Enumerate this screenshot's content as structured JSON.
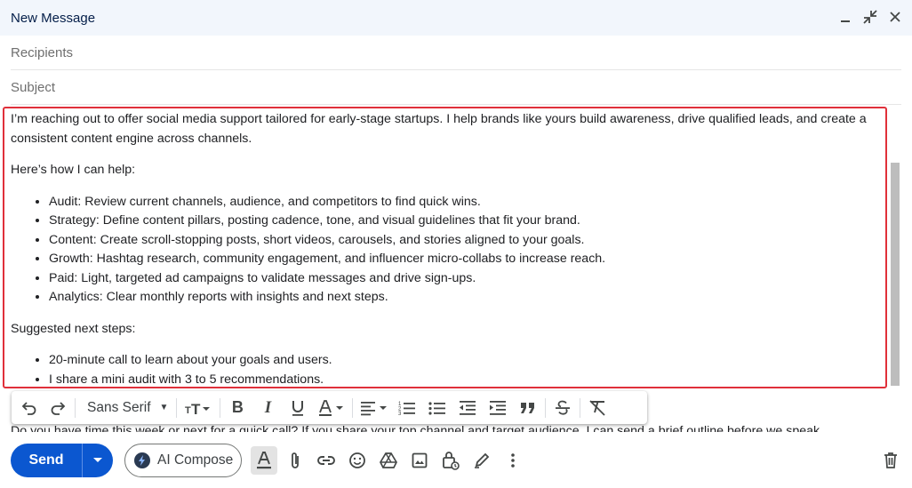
{
  "window": {
    "title": "New Message"
  },
  "fields": {
    "recipients_placeholder": "Recipients",
    "subject_placeholder": "Subject"
  },
  "body": {
    "intro": "I’m reaching out to offer social media support tailored for early-stage startups. I help brands like yours build awareness, drive qualified leads, and create a consistent content engine across channels.",
    "help_heading": "Here’s how I can help:",
    "help_items": [
      "Audit: Review current channels, audience, and competitors to find quick wins.",
      "Strategy: Define content pillars, posting cadence, tone, and visual guidelines that fit your brand.",
      "Content: Create scroll-stopping posts, short videos, carousels, and stories aligned to your goals.",
      "Growth: Hashtag research, community engagement, and influencer micro-collabs to increase reach.",
      "Paid: Light, targeted ad campaigns to validate messages and drive sign-ups.",
      "Analytics: Clear monthly reports with insights and next steps."
    ],
    "next_heading": "Suggested next steps:",
    "next_items": [
      "20-minute call to learn about your goals and users.",
      "I share a mini audit with 3 to 5 recommendations."
    ],
    "partially_hidden_line": "Do you have time this week or next for a quick call? If you share your top channel and target audience, I can send a brief outline before we speak."
  },
  "format_toolbar": {
    "font_name": "Sans Serif"
  },
  "bottom_bar": {
    "send_label": "Send",
    "ai_compose_label": "AI Compose"
  },
  "colors": {
    "send_blue": "#0b57d0",
    "highlight_border": "#e0303a",
    "titlebar_bg": "#f2f6fc"
  }
}
